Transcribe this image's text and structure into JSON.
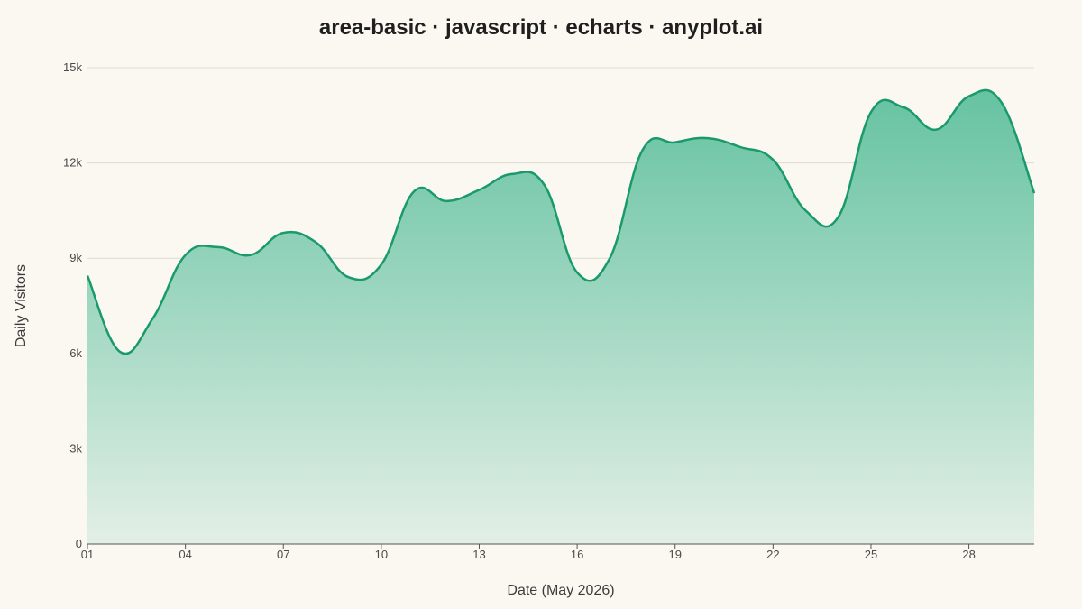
{
  "chart_data": {
    "type": "area",
    "title": "area-basic · javascript · echarts · anyplot.ai",
    "xlabel": "Date (May 2026)",
    "ylabel": "Daily Visitors",
    "x": [
      "01",
      "02",
      "03",
      "04",
      "05",
      "06",
      "07",
      "08",
      "09",
      "10",
      "11",
      "12",
      "13",
      "14",
      "15",
      "16",
      "17",
      "18",
      "19",
      "20",
      "21",
      "22",
      "23",
      "24",
      "25",
      "26",
      "27",
      "28",
      "29",
      "30"
    ],
    "x_tick_labels": [
      "01",
      "04",
      "07",
      "10",
      "13",
      "16",
      "19",
      "22",
      "25",
      "28"
    ],
    "values": [
      8450,
      6050,
      7100,
      9100,
      9350,
      9100,
      9800,
      9500,
      8400,
      8800,
      11100,
      10800,
      11150,
      11650,
      11300,
      8550,
      9000,
      12400,
      12650,
      12780,
      12500,
      12100,
      10500,
      10300,
      13600,
      13750,
      13050,
      14100,
      13900,
      11050
    ],
    "ylim": [
      0,
      15000
    ],
    "y_ticks": [
      0,
      3000,
      6000,
      9000,
      12000,
      15000
    ],
    "y_tick_labels": [
      "0",
      "3k",
      "6k",
      "9k",
      "12k",
      "15k"
    ],
    "grid": true,
    "colors": {
      "line": "#1A9A6C",
      "fill_top": "#5EC09E",
      "fill_bottom": "#E3EFE6",
      "grid": "#DEDBD2",
      "axis": "#555555",
      "background": "#FAF8F1"
    }
  }
}
